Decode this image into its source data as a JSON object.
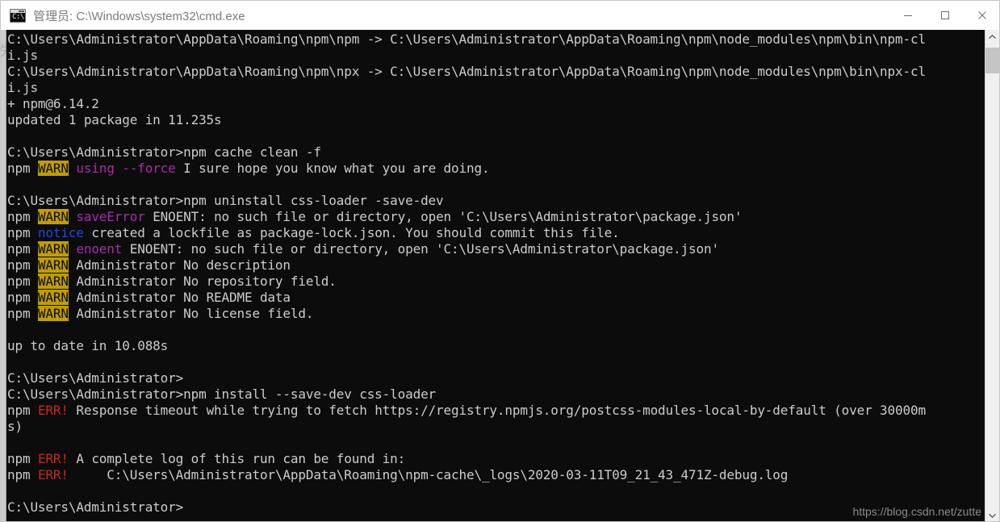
{
  "window": {
    "title": "管理员: C:\\Windows\\system32\\cmd.exe",
    "icon_glyph": "C:\\",
    "icon_name": "cmd-icon",
    "controls": {
      "minimize_label": "最小化",
      "maximize_label": "最大化",
      "close_label": "关闭"
    }
  },
  "theme": {
    "background": "#0c0c0c",
    "foreground": "#cccccc",
    "red": "#c42b1c",
    "blue": "#2048e0",
    "magenta": "#a92ba9",
    "warn_background": "#c19c00",
    "warn_foreground": "#0c0c0c",
    "titlebar_background": "#ffffff",
    "titlebar_foreground": "#7b7b7b"
  },
  "scrollbar": {
    "up_arrow": "▲",
    "down_arrow": "▼",
    "thumb_label": "滚动条滑块"
  },
  "watermark": {
    "text": "https://blog.csdn.net/zutte"
  },
  "terminal": {
    "left_strip_mark": "失",
    "lines": [
      {
        "segs": [
          {
            "t": "C:\\Users\\Administrator\\AppData\\Roaming\\npm\\npm -> C:\\Users\\Administrator\\AppData\\Roaming\\npm\\node_modules\\npm\\bin\\npm-cl",
            "c": "white"
          }
        ]
      },
      {
        "segs": [
          {
            "t": "i.js",
            "c": "white"
          }
        ]
      },
      {
        "segs": [
          {
            "t": "C:\\Users\\Administrator\\AppData\\Roaming\\npm\\npx -> C:\\Users\\Administrator\\AppData\\Roaming\\npm\\node_modules\\npm\\bin\\npx-cl",
            "c": "white"
          }
        ]
      },
      {
        "segs": [
          {
            "t": "i.js",
            "c": "white"
          }
        ]
      },
      {
        "segs": [
          {
            "t": "+ npm@6.14.2",
            "c": "white"
          }
        ]
      },
      {
        "segs": [
          {
            "t": "updated 1 package in 11.235s",
            "c": "white"
          }
        ]
      },
      {
        "segs": [
          {
            "t": "",
            "c": "white"
          }
        ]
      },
      {
        "segs": [
          {
            "t": "C:\\Users\\Administrator>npm cache clean -f",
            "c": "white"
          }
        ]
      },
      {
        "segs": [
          {
            "t": "npm ",
            "c": "white"
          },
          {
            "t": "WARN",
            "c": "warn"
          },
          {
            "t": " ",
            "c": "white"
          },
          {
            "t": "using --force",
            "c": "mag"
          },
          {
            "t": " I sure hope you know what you are doing.",
            "c": "white"
          }
        ]
      },
      {
        "segs": [
          {
            "t": "",
            "c": "white"
          }
        ]
      },
      {
        "segs": [
          {
            "t": "C:\\Users\\Administrator>npm uninstall css-loader -save-dev",
            "c": "white"
          }
        ]
      },
      {
        "segs": [
          {
            "t": "npm ",
            "c": "white"
          },
          {
            "t": "WARN",
            "c": "warn"
          },
          {
            "t": " ",
            "c": "white"
          },
          {
            "t": "saveError",
            "c": "mag"
          },
          {
            "t": " ENOENT: no such file or directory, open 'C:\\Users\\Administrator\\package.json'",
            "c": "white"
          }
        ]
      },
      {
        "segs": [
          {
            "t": "npm ",
            "c": "white"
          },
          {
            "t": "notice",
            "c": "blue"
          },
          {
            "t": " created a lockfile as package-lock.json. You should commit this file.",
            "c": "white"
          }
        ]
      },
      {
        "segs": [
          {
            "t": "npm ",
            "c": "white"
          },
          {
            "t": "WARN",
            "c": "warn"
          },
          {
            "t": " ",
            "c": "white"
          },
          {
            "t": "enoent",
            "c": "mag"
          },
          {
            "t": " ENOENT: no such file or directory, open 'C:\\Users\\Administrator\\package.json'",
            "c": "white"
          }
        ]
      },
      {
        "segs": [
          {
            "t": "npm ",
            "c": "white"
          },
          {
            "t": "WARN",
            "c": "warn"
          },
          {
            "t": " Administrator No description",
            "c": "white"
          }
        ]
      },
      {
        "segs": [
          {
            "t": "npm ",
            "c": "white"
          },
          {
            "t": "WARN",
            "c": "warn"
          },
          {
            "t": " Administrator No repository field.",
            "c": "white"
          }
        ]
      },
      {
        "segs": [
          {
            "t": "npm ",
            "c": "white"
          },
          {
            "t": "WARN",
            "c": "warn"
          },
          {
            "t": " Administrator No README data",
            "c": "white"
          }
        ]
      },
      {
        "segs": [
          {
            "t": "npm ",
            "c": "white"
          },
          {
            "t": "WARN",
            "c": "warn"
          },
          {
            "t": " Administrator No license field.",
            "c": "white"
          }
        ]
      },
      {
        "segs": [
          {
            "t": "",
            "c": "white"
          }
        ]
      },
      {
        "segs": [
          {
            "t": "up to date in 10.088s",
            "c": "white"
          }
        ]
      },
      {
        "segs": [
          {
            "t": "",
            "c": "white"
          }
        ]
      },
      {
        "segs": [
          {
            "t": "C:\\Users\\Administrator>",
            "c": "white"
          }
        ]
      },
      {
        "segs": [
          {
            "t": "C:\\Users\\Administrator>npm install --save-dev css-loader",
            "c": "white"
          }
        ]
      },
      {
        "segs": [
          {
            "t": "npm ",
            "c": "white"
          },
          {
            "t": "ERR!",
            "c": "red"
          },
          {
            "t": " Response timeout while trying to fetch https://registry.npmjs.org/postcss-modules-local-by-default (over 30000m",
            "c": "white"
          }
        ]
      },
      {
        "segs": [
          {
            "t": "s)",
            "c": "white"
          }
        ]
      },
      {
        "segs": [
          {
            "t": "",
            "c": "white"
          }
        ]
      },
      {
        "segs": [
          {
            "t": "npm ",
            "c": "white"
          },
          {
            "t": "ERR!",
            "c": "red"
          },
          {
            "t": " A complete log of this run can be found in:",
            "c": "white"
          }
        ]
      },
      {
        "segs": [
          {
            "t": "npm ",
            "c": "white"
          },
          {
            "t": "ERR!",
            "c": "red"
          },
          {
            "t": "     C:\\Users\\Administrator\\AppData\\Roaming\\npm-cache\\_logs\\2020-03-11T09_21_43_471Z-debug.log",
            "c": "white"
          }
        ]
      },
      {
        "segs": [
          {
            "t": "",
            "c": "white"
          }
        ]
      },
      {
        "segs": [
          {
            "t": "C:\\Users\\Administrator>",
            "c": "white"
          }
        ]
      }
    ]
  }
}
